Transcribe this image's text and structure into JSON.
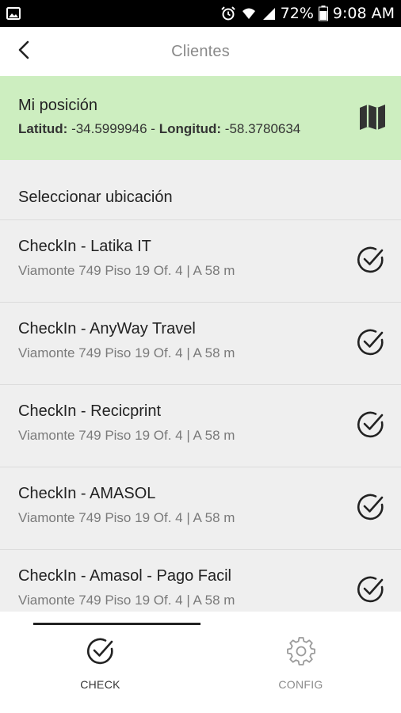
{
  "status_bar": {
    "battery": "72%",
    "time": "9:08 AM",
    "icons": [
      "image-icon",
      "alarm-icon",
      "wifi-icon",
      "signal-icon",
      "battery-icon"
    ]
  },
  "app_bar": {
    "title": "Clientes",
    "back_icon": "chevron-left-icon"
  },
  "position": {
    "title": "Mi posición",
    "lat_label": "Latitud:",
    "lat_value": "-34.5999946",
    "separator": "-",
    "lng_label": "Longitud:",
    "lng_value": "-58.3780634",
    "map_icon": "map-icon",
    "background": "#cdeec0"
  },
  "section": {
    "title": "Seleccionar ubicación"
  },
  "locations": [
    {
      "title": "CheckIn - Latika IT",
      "subtitle": "Viamonte 749 Piso 19 Of. 4 | A 58 m"
    },
    {
      "title": "CheckIn - AnyWay Travel",
      "subtitle": "Viamonte 749 Piso 19 Of. 4 | A 58 m"
    },
    {
      "title": "CheckIn - Recicprint",
      "subtitle": "Viamonte 749 Piso 19 Of. 4 | A 58 m"
    },
    {
      "title": "CheckIn - AMASOL",
      "subtitle": "Viamonte 749 Piso 19 Of. 4 | A 58 m"
    },
    {
      "title": "CheckIn - Amasol - Pago Facil",
      "subtitle": "Viamonte 749 Piso 19 Of. 4 | A 58 m"
    }
  ],
  "bottom_nav": {
    "tabs": [
      {
        "label": "CHECK",
        "icon": "check-circle-icon",
        "active": true
      },
      {
        "label": "CONFIG",
        "icon": "gear-icon",
        "active": false
      }
    ]
  }
}
